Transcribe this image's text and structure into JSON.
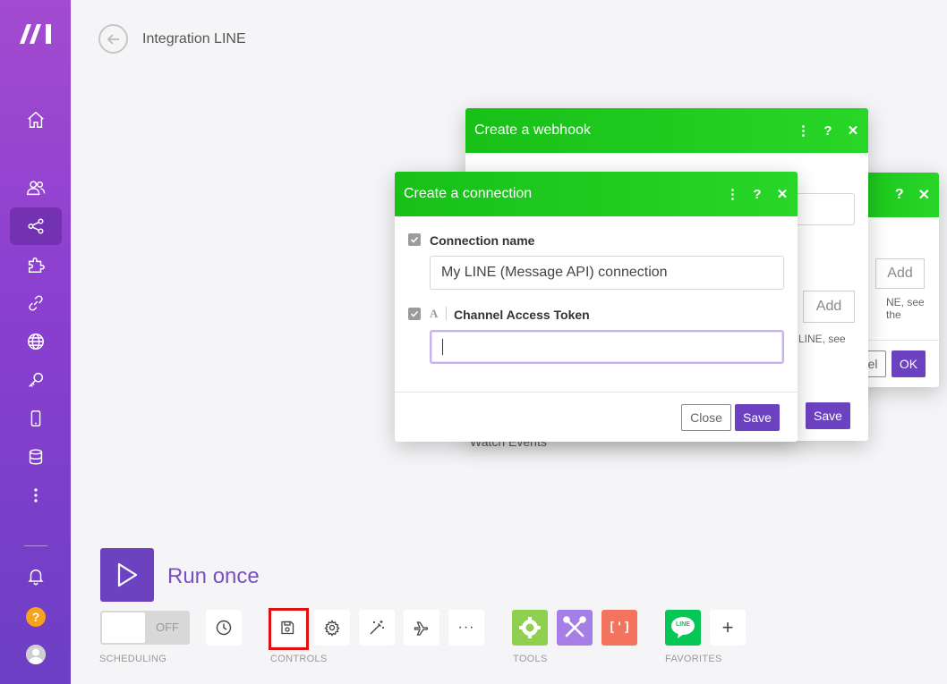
{
  "app": {
    "page_title": "Integration LINE"
  },
  "sidebar": {
    "items": [
      "home",
      "team",
      "scenarios",
      "templates",
      "connections",
      "webhooks",
      "keys",
      "devices",
      "data-stores",
      "more"
    ],
    "help_label": "?"
  },
  "webhook_dialog": {
    "title": "Create a webhook",
    "add_label": "Add",
    "hint_text": "LINE, see",
    "save_label": "Save",
    "watch_label": "Watch Events"
  },
  "back_dialog": {
    "add_label": "Add",
    "hint_text": "NE, see the",
    "cancel_partial": "el",
    "ok_label": "OK"
  },
  "connection_dialog": {
    "title": "Create a connection",
    "connection_name_label": "Connection name",
    "connection_name_value": "My LINE (Message API) connection",
    "token_label": "Channel Access Token",
    "token_value": "",
    "close_label": "Close",
    "save_label": "Save"
  },
  "bottom": {
    "run_once_label": "Run once",
    "toggle_off_label": "OFF",
    "scheduling_label": "SCHEDULING",
    "controls_label": "CONTROLS",
    "tools_label": "TOOLS",
    "favorites_label": "FAVORITES",
    "line_label": "LINE",
    "more_label": "···",
    "add_label": "+"
  },
  "colors": {
    "accent": "#6d42c1",
    "header_green": "#1fc91f",
    "tools_green": "#8fd14f",
    "tools_purple": "#a57fe6",
    "tools_orange": "#f4735e",
    "line_green": "#06c755"
  }
}
